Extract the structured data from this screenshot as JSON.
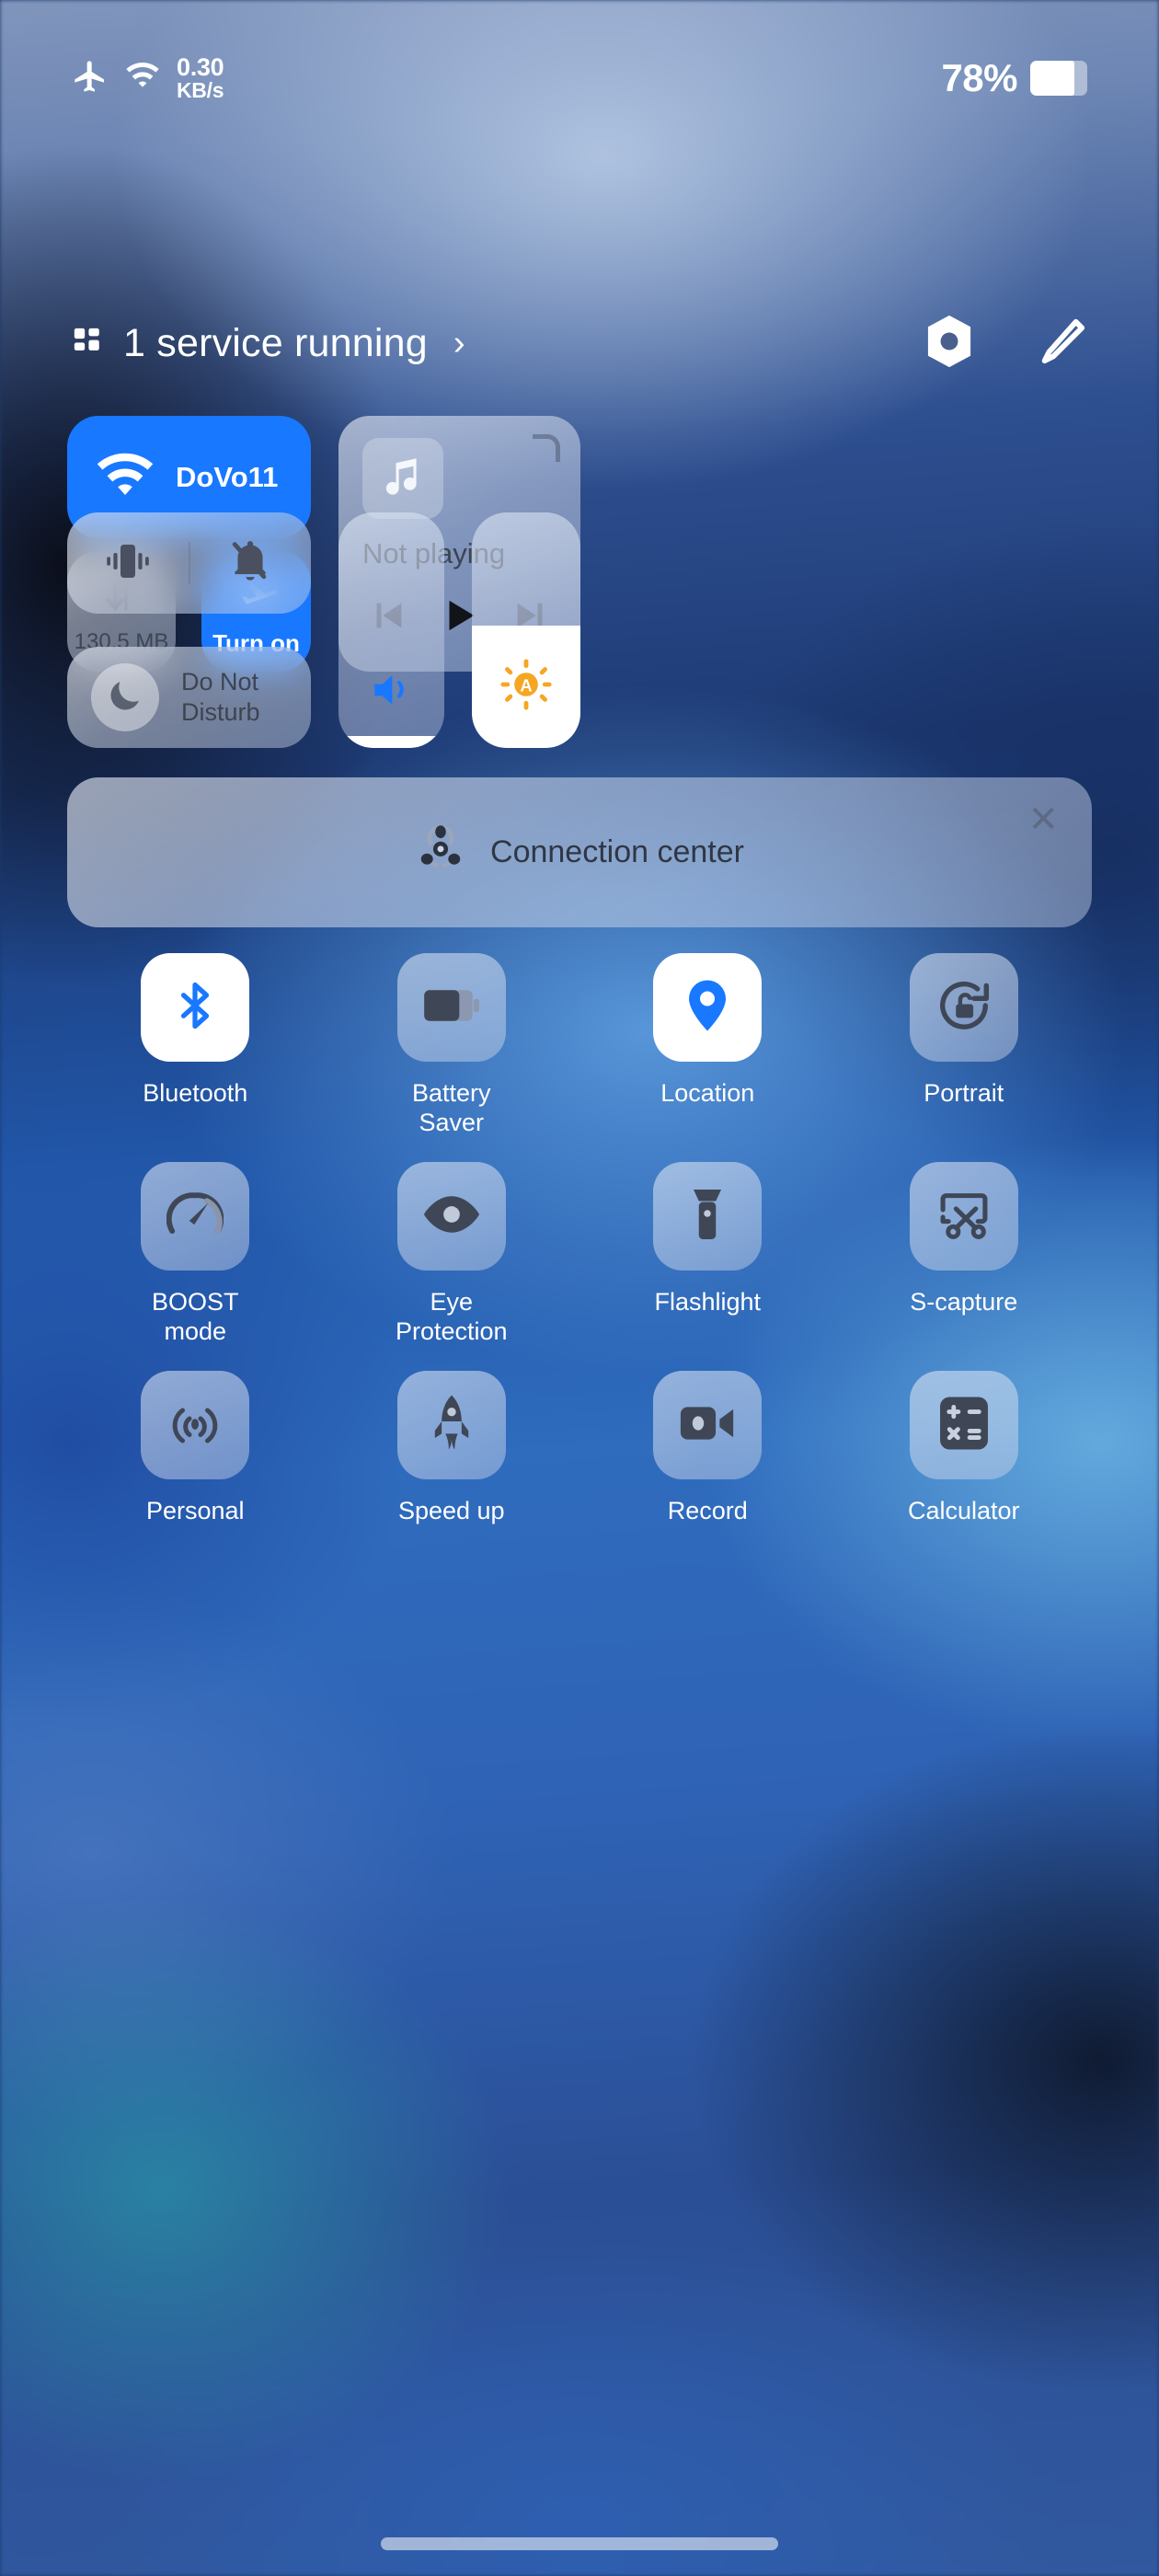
{
  "status_bar": {
    "airplane_icon": "airplane-icon",
    "wifi_icon": "wifi-icon",
    "network_speed_value": "0.30",
    "network_speed_unit": "KB/s",
    "battery_percent": "78%",
    "battery_icon": "battery-icon"
  },
  "header": {
    "grid_icon": "grid-icon",
    "title": "1 service running",
    "chevron": "›",
    "settings_icon": "hex-nut-settings-icon",
    "edit_icon": "pencil-edit-icon"
  },
  "wifi_tile": {
    "name": "DoVo11",
    "icon": "wifi-icon",
    "state": "on",
    "accent": "#1878ff"
  },
  "data_tile": {
    "value": "130.5 MB",
    "icon": "data-transfer-icon",
    "state": "off"
  },
  "airplane_tile": {
    "label": "Turn on",
    "icon": "airplane-icon",
    "state": "on"
  },
  "media": {
    "album_art_icon": "music-note-icon",
    "title": "Not playing",
    "prev_icon": "skip-previous-icon",
    "play_icon": "play-icon",
    "next_icon": "skip-next-icon",
    "corner_icon": "resize-corner-icon"
  },
  "ring_tile": {
    "vibrate_icon": "vibrate-icon",
    "silent_icon": "bell-off-icon"
  },
  "dnd_tile": {
    "label": "Do Not\nDisturb",
    "line1": "Do Not",
    "line2": "Disturb",
    "icon": "moon-icon"
  },
  "volume_slider": {
    "icon": "speaker-volume-icon",
    "level_percent": 5,
    "icon_color": "#1878ff"
  },
  "brightness_slider": {
    "icon": "auto-brightness-icon",
    "level_percent": 52,
    "icon_color": "#f5a623",
    "auto_letter": "A"
  },
  "connection_center": {
    "label": "Connection center",
    "icon": "connection-share-icon",
    "close": "✕"
  },
  "apps": [
    {
      "label": "Bluetooth",
      "icon": "bluetooth-icon",
      "state": "on"
    },
    {
      "label": "Battery\nSaver",
      "line1": "Battery",
      "line2": "Saver",
      "icon": "battery-saver-icon",
      "state": "off"
    },
    {
      "label": "Location",
      "icon": "location-pin-icon",
      "state": "on"
    },
    {
      "label": "Portrait",
      "icon": "rotation-lock-icon",
      "state": "off"
    },
    {
      "label": "BOOST\nmode",
      "line1": "BOOST",
      "line2": "mode",
      "icon": "speedometer-icon",
      "state": "off"
    },
    {
      "label": "Eye\nProtection",
      "line1": "Eye",
      "line2": "Protection",
      "icon": "eye-icon",
      "state": "off"
    },
    {
      "label": "Flashlight",
      "icon": "flashlight-icon",
      "state": "off"
    },
    {
      "label": "S-capture",
      "icon": "screenshot-scissors-icon",
      "state": "off"
    },
    {
      "label": "Personal",
      "icon": "hotspot-icon",
      "state": "off"
    },
    {
      "label": "Speed up",
      "icon": "rocket-icon",
      "state": "off"
    },
    {
      "label": "Record",
      "icon": "video-camera-icon",
      "state": "off"
    },
    {
      "label": "Calculator",
      "icon": "calculator-icon",
      "state": "off"
    }
  ],
  "home_indicator": "home-indicator-bar"
}
